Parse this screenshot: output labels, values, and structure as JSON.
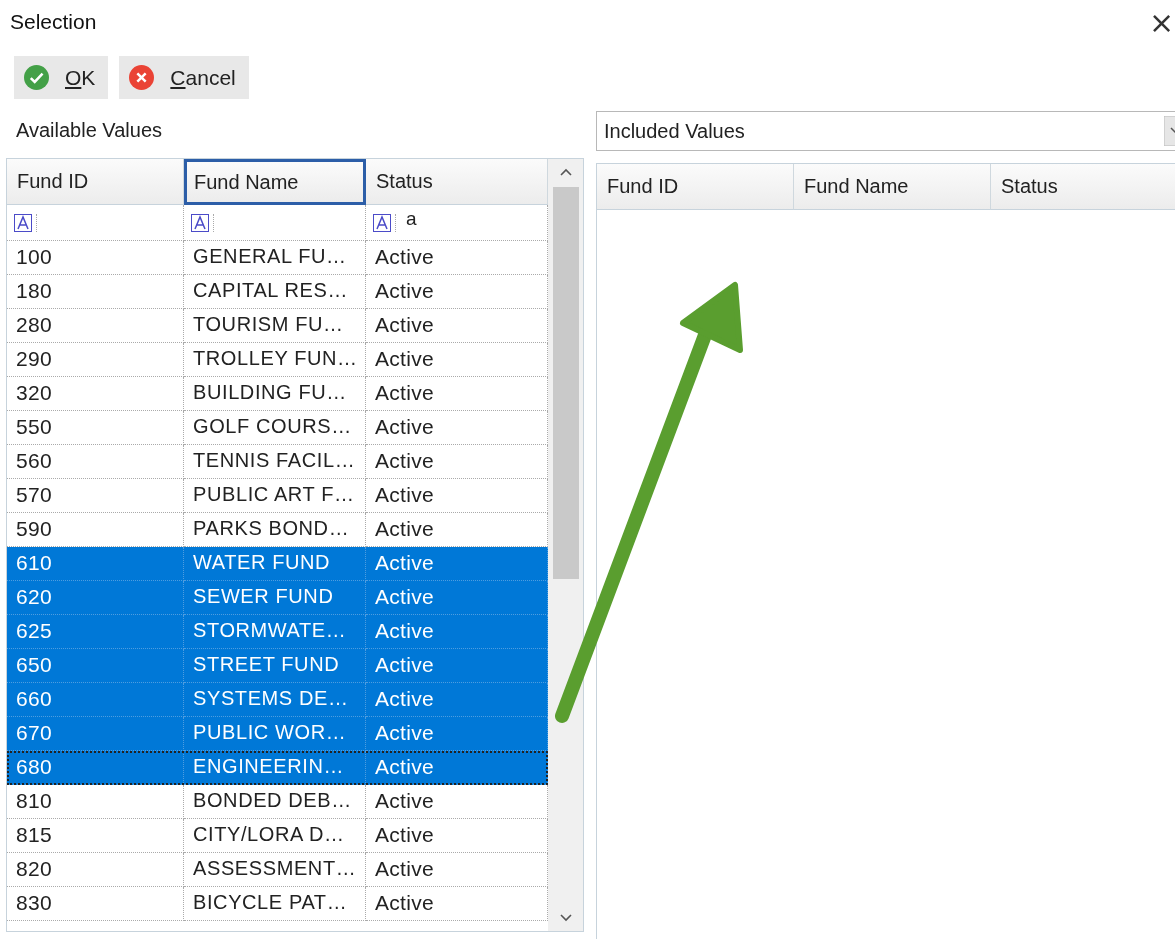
{
  "window": {
    "title": "Selection",
    "close": "×"
  },
  "toolbar": [
    {
      "kind": "ok",
      "label": "OK"
    },
    {
      "kind": "cancel",
      "label": "Cancel"
    }
  ],
  "available": {
    "label": "Available Values",
    "columns": [
      {
        "label": "Fund ID",
        "focused": false
      },
      {
        "label": "Fund Name",
        "focused": true
      },
      {
        "label": "Status",
        "focused": false,
        "filter": "a"
      }
    ],
    "rows": [
      {
        "cells": [
          "100",
          "GENERAL FU…",
          "Active"
        ],
        "selected": false,
        "focused": false
      },
      {
        "cells": [
          "180",
          "CAPITAL RES…",
          "Active"
        ],
        "selected": false,
        "focused": false
      },
      {
        "cells": [
          "280",
          "TOURISM FU…",
          "Active"
        ],
        "selected": false,
        "focused": false
      },
      {
        "cells": [
          "290",
          "TROLLEY FUN…",
          "Active"
        ],
        "selected": false,
        "focused": false
      },
      {
        "cells": [
          "320",
          "BUILDING FU…",
          "Active"
        ],
        "selected": false,
        "focused": false
      },
      {
        "cells": [
          "550",
          "GOLF COURS…",
          "Active"
        ],
        "selected": false,
        "focused": false
      },
      {
        "cells": [
          "560",
          "TENNIS FACIL…",
          "Active"
        ],
        "selected": false,
        "focused": false
      },
      {
        "cells": [
          "570",
          "PUBLIC ART F…",
          "Active"
        ],
        "selected": false,
        "focused": false
      },
      {
        "cells": [
          "590",
          "PARKS BOND…",
          "Active"
        ],
        "selected": false,
        "focused": false
      },
      {
        "cells": [
          "610",
          "WATER FUND",
          "Active"
        ],
        "selected": true,
        "focused": false
      },
      {
        "cells": [
          "620",
          "SEWER FUND",
          "Active"
        ],
        "selected": true,
        "focused": false
      },
      {
        "cells": [
          "625",
          "STORMWATE…",
          "Active"
        ],
        "selected": true,
        "focused": false
      },
      {
        "cells": [
          "650",
          "STREET FUND",
          "Active"
        ],
        "selected": true,
        "focused": false
      },
      {
        "cells": [
          "660",
          "SYSTEMS DE…",
          "Active"
        ],
        "selected": true,
        "focused": false
      },
      {
        "cells": [
          "670",
          "PUBLIC WOR…",
          "Active"
        ],
        "selected": true,
        "focused": false
      },
      {
        "cells": [
          "680",
          "ENGINEERIN…",
          "Active"
        ],
        "selected": true,
        "focused": true
      },
      {
        "cells": [
          "810",
          "BONDED DEB…",
          "Active"
        ],
        "selected": false,
        "focused": false
      },
      {
        "cells": [
          "815",
          "CITY/LORA D…",
          "Active"
        ],
        "selected": false,
        "focused": false
      },
      {
        "cells": [
          "820",
          "ASSESSMENT…",
          "Active"
        ],
        "selected": false,
        "focused": false
      },
      {
        "cells": [
          "830",
          "BICYCLE PAT…",
          "Active"
        ],
        "selected": false,
        "focused": false
      }
    ]
  },
  "included": {
    "dropdown": "Included Values",
    "columns": [
      "Fund ID",
      "Fund Name",
      "Status"
    ]
  }
}
